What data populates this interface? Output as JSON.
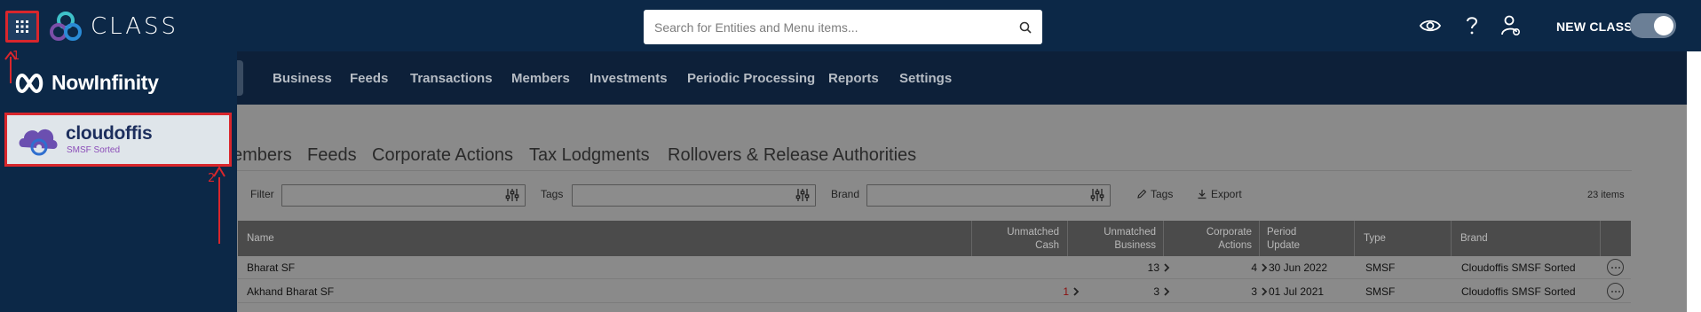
{
  "header": {
    "app_name": "CLASS",
    "search_placeholder": "Search for Entities and Menu items...",
    "new_class_label": "NEW CLASS",
    "new_class_toggle_on": true
  },
  "nav": {
    "items": [
      "Business",
      "Feeds",
      "Transactions",
      "Members",
      "Investments",
      "Periodic Processing",
      "Reports",
      "Settings"
    ]
  },
  "tabs": [
    "embers",
    "Feeds",
    "Corporate Actions",
    "Tax Lodgments",
    "Rollovers & Release Authorities"
  ],
  "filters": {
    "filter_label": "Filter",
    "tags_label": "Tags",
    "brand_label": "Brand",
    "tags_action": "Tags",
    "export_action": "Export",
    "items_count": "23 items"
  },
  "table": {
    "headers": {
      "name": "Name",
      "unmatched_cash": [
        "Unmatched",
        "Cash"
      ],
      "unmatched_business": [
        "Unmatched",
        "Business"
      ],
      "corporate_actions": [
        "Corporate",
        "Actions"
      ],
      "period_update": [
        "Period",
        "Update"
      ],
      "type": "Type",
      "brand": "Brand"
    },
    "rows": [
      {
        "name": "Bharat SF",
        "unmatched_cash": "",
        "unmatched_business": "13",
        "corporate_actions": "4",
        "period_update": "30 Jun 2022",
        "type": "SMSF",
        "brand": "Cloudoffis SMSF Sorted"
      },
      {
        "name": "Akhand Bharat SF",
        "unmatched_cash": "1",
        "unmatched_business": "3",
        "corporate_actions": "3",
        "period_update": "01 Jul 2021",
        "type": "SMSF",
        "brand": "Cloudoffis SMSF Sorted"
      }
    ]
  },
  "app_switcher": {
    "items": [
      {
        "label": "NowInfinity"
      },
      {
        "label": "cloudoffis",
        "sublabel": "SMSF Sorted"
      }
    ]
  },
  "annotations": {
    "step1": "1",
    "step2": "2",
    "color": "#d9262c"
  },
  "colors": {
    "header_bg": "#0c2847",
    "accent_red": "#d9262c"
  }
}
